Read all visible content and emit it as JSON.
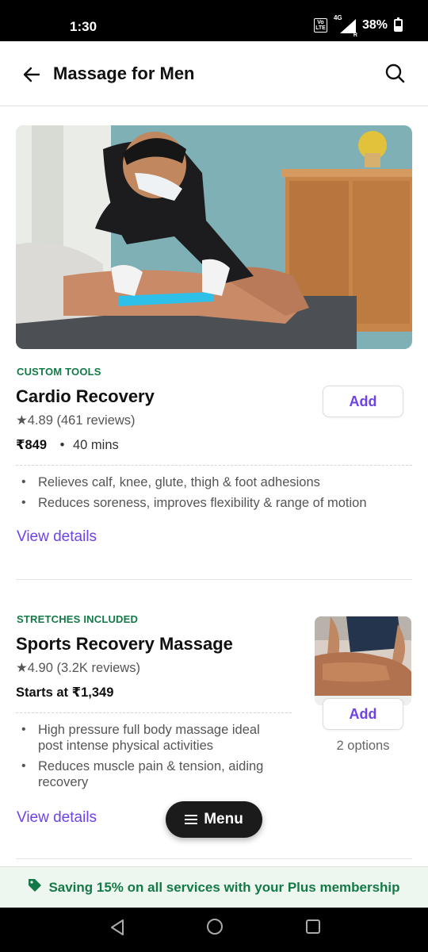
{
  "status": {
    "time": "1:30",
    "volte": "VoLTE",
    "network": "4G",
    "battery": "38%"
  },
  "header": {
    "title": "Massage for Men"
  },
  "card1": {
    "tag": "CUSTOM TOOLS",
    "title": "Cardio Recovery",
    "rating": "4.89 (461 reviews)",
    "price": "₹849",
    "duration": "40 mins",
    "add_label": "Add",
    "bullets": [
      "Relieves calf, knee, glute, thigh & foot adhesions",
      "Reduces soreness, improves flexibility & range of motion"
    ],
    "view_details": "View details"
  },
  "card2": {
    "tag": "STRETCHES INCLUDED",
    "title": "Sports Recovery Massage",
    "rating": "4.90 (3.2K reviews)",
    "price": "Starts at ₹1,349",
    "add_label": "Add",
    "options": "2 options",
    "bullets": [
      "High pressure full body massage ideal post intense physical activities",
      "Reduces muscle pain & tension, aiding recovery"
    ],
    "view_details": "View details"
  },
  "menu": {
    "label": "Menu"
  },
  "plus_banner": {
    "text": "Saving 15% on all services with your Plus membership"
  },
  "colors": {
    "accent": "#6e42e5",
    "green": "#137a47",
    "banner_bg": "#eef6f0"
  },
  "icons": [
    "back-arrow-icon",
    "search-icon",
    "star-icon",
    "tag-icon",
    "hamburger-icon"
  ]
}
